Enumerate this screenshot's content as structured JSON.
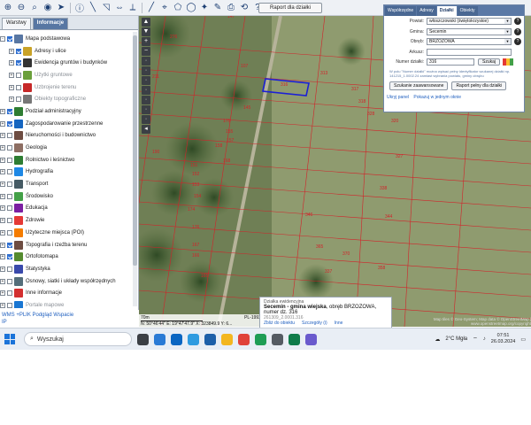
{
  "toolbar": {
    "raport_button": "Raport dla działki"
  },
  "left_panel": {
    "tabs": [
      "Warstwy",
      "Informacje"
    ],
    "layers": [
      {
        "label": "Mapa podstawowa",
        "checked": true,
        "expand": "-",
        "icon": "globe-icon",
        "sub": false,
        "dim": false
      },
      {
        "label": "Adresy i ulice",
        "checked": true,
        "expand": "+",
        "icon": "address-icon",
        "sub": true,
        "dim": false
      },
      {
        "label": "Ewidencja gruntów i budynków",
        "checked": true,
        "expand": "+",
        "icon": "cadastre-icon",
        "sub": true,
        "dim": false
      },
      {
        "label": "Użytki gruntowe",
        "checked": false,
        "expand": "+",
        "icon": "land-use-icon",
        "sub": true,
        "dim": true
      },
      {
        "label": "Uzbrojenie terenu",
        "checked": false,
        "expand": "+",
        "icon": "utilities-icon",
        "sub": true,
        "dim": true
      },
      {
        "label": "Obiekty topograficzne",
        "checked": false,
        "expand": "+",
        "icon": "topo-objects-icon",
        "sub": true,
        "dim": true
      },
      {
        "label": "Podział administracyjny",
        "checked": true,
        "expand": "+",
        "icon": "admin-division-icon",
        "sub": false,
        "dim": false
      },
      {
        "label": "Zagospodarowanie przestrzenne",
        "checked": true,
        "expand": "+",
        "icon": "spatial-planning-icon",
        "sub": false,
        "dim": false
      },
      {
        "label": "Nieruchomości i budownictwo",
        "checked": false,
        "expand": "+",
        "icon": "buildings-icon",
        "sub": false,
        "dim": false
      },
      {
        "label": "Geologia",
        "checked": false,
        "expand": "+",
        "icon": "geology-icon",
        "sub": false,
        "dim": false
      },
      {
        "label": "Rolnictwo i leśnictwo",
        "checked": false,
        "expand": "+",
        "icon": "forestry-icon",
        "sub": false,
        "dim": false
      },
      {
        "label": "Hydrografia",
        "checked": false,
        "expand": "+",
        "icon": "hydrography-icon",
        "sub": false,
        "dim": false
      },
      {
        "label": "Transport",
        "checked": false,
        "expand": "+",
        "icon": "transport-icon",
        "sub": false,
        "dim": false
      },
      {
        "label": "Środowisko",
        "checked": false,
        "expand": "+",
        "icon": "environment-icon",
        "sub": false,
        "dim": false
      },
      {
        "label": "Edukacja",
        "checked": false,
        "expand": "+",
        "icon": "education-icon",
        "sub": false,
        "dim": false
      },
      {
        "label": "Zdrowie",
        "checked": false,
        "expand": "+",
        "icon": "health-icon",
        "sub": false,
        "dim": false
      },
      {
        "label": "Użyteczne miejsca (POI)",
        "checked": false,
        "expand": "+",
        "icon": "poi-icon",
        "sub": false,
        "dim": false
      },
      {
        "label": "Topografia i rzeźba terenu",
        "checked": true,
        "expand": "+",
        "icon": "terrain-icon",
        "sub": false,
        "dim": false
      },
      {
        "label": "Ortofotomapa",
        "checked": true,
        "expand": "+",
        "icon": "orthophoto-icon",
        "sub": false,
        "dim": false
      },
      {
        "label": "Statystyka",
        "checked": false,
        "expand": "+",
        "icon": "statistics-icon",
        "sub": false,
        "dim": false
      },
      {
        "label": "Osnowy, siatki i układy współrzędnych",
        "checked": false,
        "expand": "+",
        "icon": "grid-icon",
        "sub": false,
        "dim": false
      },
      {
        "label": "Inne informacje",
        "checked": false,
        "expand": "+",
        "icon": "info-icon",
        "sub": false,
        "dim": false
      },
      {
        "label": "Portale mapowe",
        "checked": false,
        "expand": "+",
        "icon": "portals-icon",
        "sub": false,
        "dim": true
      }
    ],
    "footer_links": "WMS +PLIK Podgląd Wspacie",
    "footer_ip": "IP"
  },
  "search_panel": {
    "tabs": [
      "Współrzędne",
      "Adresy",
      "Działki",
      "Obiekty"
    ],
    "powiat_label": "Powiat:",
    "powiat_value": "włoszczowski (świętokrzyskie)",
    "gmina_label": "Gmina:",
    "gmina_value": "Secemin",
    "obreb_label": "Obręb:",
    "obreb_value": "BRZOZOWA",
    "arkusz_label": "Arkusz:",
    "arkusz_value": "",
    "numer_label": "Numer działki:",
    "numer_value": "316",
    "szukaj_button": "Szukaj",
    "note": "W polu \"Numer działki\" można wpisać pełny identyfikator szukanej działki np. 141215_1.0002.24 zamiast wybrania powiatu, gminy obrębu",
    "advanced_button": "Szukanie zaawansowane",
    "report_button": "Raport pełny dla działki",
    "hide_link": "Ukryj panel",
    "show_link": "Pokazuj w jednym oknie"
  },
  "info_popup": {
    "title": "Działka ewidencyjna",
    "main_prefix": "Secemin - gmina wiejska",
    "main_rest": ", obręb BRZOZOWA, numer dz. 316",
    "id": "261309_2.0001.316",
    "zoom_link": "Zbliż do obiektu",
    "details_link": "Szczegóły (i)",
    "other_link": "Inne"
  },
  "scale": {
    "distance": "70m",
    "pl_code": "PL-1992",
    "coords": "N: 50°46'44\"   E: 19°47'47.9\"   X: 323849.9   Y: 6..."
  },
  "attribution": "Map tiles © Geo-System; Map data © OpenStreetMap | www.openstreetmap.org/copyright",
  "map_plots": [
    "316",
    "313",
    "317",
    "107",
    "147",
    "276",
    "211",
    "175",
    "155",
    "157",
    "158",
    "168",
    "151",
    "152",
    "153",
    "154",
    "174",
    "176",
    "190",
    "167",
    "166",
    "165",
    "318",
    "328",
    "320",
    "327",
    "338",
    "344",
    "346",
    "365",
    "370",
    "337",
    "358",
    "145"
  ],
  "taskbar": {
    "search_placeholder": "Wyszukaj",
    "weather": "2°C  Mgła",
    "time": "07:51",
    "date": "26.03.2024"
  }
}
